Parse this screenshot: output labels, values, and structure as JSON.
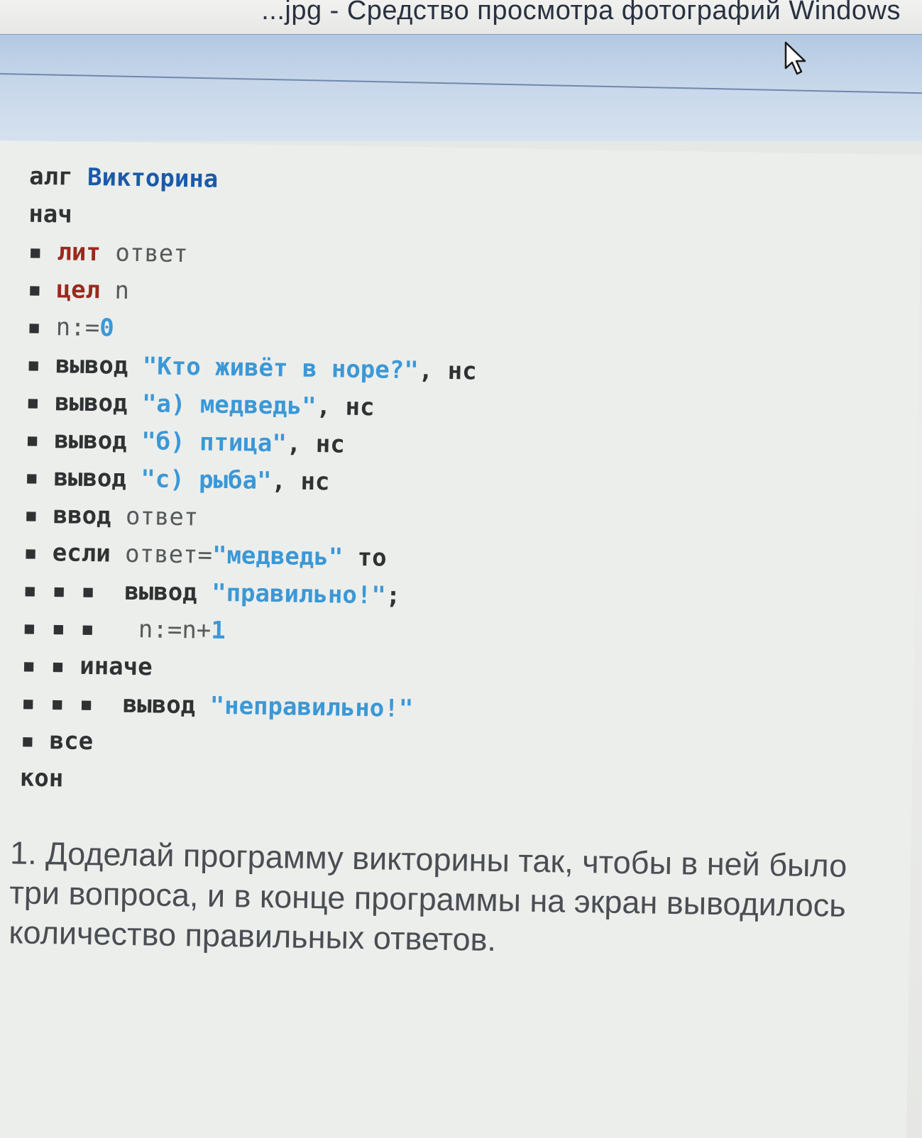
{
  "window": {
    "title": "...jpg - Средство просмотра фотографий Windows"
  },
  "code": {
    "line1": {
      "kw": "алг",
      "name": "Викторина"
    },
    "line2": {
      "kw": "нач"
    },
    "line3": {
      "dots": "▪",
      "kw": "лит",
      "var": "ответ"
    },
    "line4": {
      "dots": "▪",
      "kw": "цел",
      "var": "n"
    },
    "line5": {
      "dots": "▪",
      "var": "n:=",
      "num": "0"
    },
    "line6": {
      "dots": "▪",
      "kw": "вывод",
      "str": "\"Кто живёт в норе?\"",
      "tail": ", нс"
    },
    "line7": {
      "dots": "▪",
      "kw": "вывод",
      "str": "\"а) медведь\"",
      "tail": ", нс"
    },
    "line8": {
      "dots": "▪",
      "kw": "вывод",
      "str": "\"б) птица\"",
      "tail": ", нс"
    },
    "line9": {
      "dots": "▪",
      "kw": "вывод",
      "str": "\"с) рыба\"",
      "tail": ", нс"
    },
    "line10": {
      "dots": "▪",
      "kw": "ввод",
      "var": "ответ"
    },
    "line11": {
      "dots": "▪",
      "kw": "если",
      "var": "ответ=",
      "str": "\"медведь\"",
      "kw2": "то"
    },
    "line12": {
      "dots": "▪ ▪ ▪",
      "kw": "вывод",
      "str": "\"правильно!\"",
      "tail": ";"
    },
    "line13": {
      "dots": "▪ ▪ ▪",
      "var": "n:=n+",
      "num": "1"
    },
    "line14": {
      "dots": "▪ ▪",
      "kw": "иначе"
    },
    "line15": {
      "dots": "▪ ▪ ▪",
      "kw": "вывод",
      "str": "\"неправильно!\""
    },
    "line16": {
      "dots": "▪",
      "kw": "все"
    },
    "line17": {
      "kw": "кон"
    }
  },
  "task": {
    "text": "1. Доделай программу викторины так, чтобы в ней было три вопроса, и в конце программы на экран выводилось количество правильных ответов."
  },
  "colors": {
    "keyword": "#2f3232",
    "type_keyword": "#9a2a1e",
    "algorithm_name": "#1c5aa8",
    "string_literal": "#3b98d6",
    "toolbar": "#c7d7ea"
  }
}
